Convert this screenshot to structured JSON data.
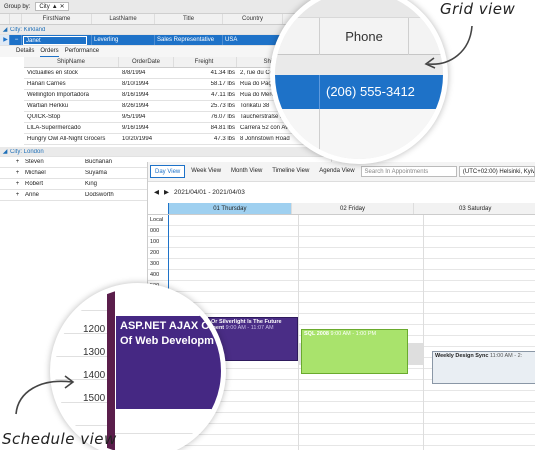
{
  "labels": {
    "grid_view": "Grid view",
    "schedule_view": "Schedule view"
  },
  "grid": {
    "group_by_label": "Group by:",
    "group_chip": "City",
    "columns": [
      "FirstName",
      "LastName",
      "Title",
      "Country"
    ],
    "group_kirkland": "City: Kirkland",
    "selected_row": {
      "first": "Janet",
      "last": "Leverling",
      "title": "Sales Representative",
      "country": "USA"
    },
    "tabs": [
      "Details",
      "Orders",
      "Performance"
    ],
    "sub_columns": [
      "ShipName",
      "OrderDate",
      "Freight",
      "ShipA"
    ],
    "orders": [
      {
        "ship": "Victuailles en stock",
        "date": "8/8/1994",
        "freight": "41.34 lbs",
        "addr": "2, rue du Comm"
      },
      {
        "ship": "Hanari Carnes",
        "date": "8/10/1994",
        "freight": "58.17 lbs",
        "addr": "Rua do Paço, 67"
      },
      {
        "ship": "Wellington Importadora",
        "date": "8/16/1994",
        "freight": "47.11 lbs",
        "addr": "Rua do Mercado, 1"
      },
      {
        "ship": "Wartian Herkku",
        "date": "8/26/1994",
        "freight": "25.73 lbs",
        "addr": "Torikatu 38"
      },
      {
        "ship": "QUICK-Stop",
        "date": "9/5/1994",
        "freight": "76.07 lbs",
        "addr": "Taucherstraße 10"
      },
      {
        "ship": "LILA-Supermercado",
        "date": "9/16/1994",
        "freight": "84.81 lbs",
        "addr": "Carrera 52 con Ave. Bolí..."
      },
      {
        "ship": "Hungry Owl All-Night Grocers",
        "date": "10/20/1994",
        "freight": "47.3 lbs",
        "addr": "8 Johnstown Road"
      }
    ],
    "group_london": "City: London",
    "london_rows": [
      {
        "first": "Steven",
        "last": "Buchanan"
      },
      {
        "first": "Michael",
        "last": "Suyama"
      },
      {
        "first": "Robert",
        "last": "King"
      },
      {
        "first": "Anne",
        "last": "Dodsworth"
      }
    ],
    "magnifier": {
      "header": "Phone",
      "value": "(206) 555-3412"
    }
  },
  "scheduler": {
    "views": [
      "Day View",
      "Week View",
      "Month View",
      "Timeline View",
      "Agenda View"
    ],
    "active_view": "Day View",
    "search_placeholder": "Search In Appointments",
    "timezone": "(UTC+02:00) Helsinki, Kyiv",
    "date_range": "2021/04/01 - 2021/04/03",
    "days": [
      "01 Thursday",
      "02 Friday",
      "03 Saturday"
    ],
    "local_label": "Local",
    "times": [
      "1000",
      "1100",
      "1200",
      "1300",
      "1400",
      "1500",
      "1600",
      "1700",
      "1800",
      "1900"
    ],
    "appointments": {
      "silverlight": {
        "title": "Or Silverlight Is The Future",
        "sub": "ment",
        "time": "9:00 AM - 11:07 AM"
      },
      "sql": {
        "title": "SQL 2008",
        "time": "9:00 AM - 1:00 PM"
      },
      "wds": {
        "title": "Weekly Design Sync",
        "time": "11:00 AM - 2:"
      }
    },
    "magnifier": {
      "line1": "ASP.NET AJAX O",
      "line2": "Of Web Developm",
      "times": [
        "1200",
        "1300",
        "1400",
        "1500"
      ]
    }
  },
  "colors": {
    "accent": "#1e72c8",
    "selected_row": "#1e72c8",
    "sql": "#a9e36c",
    "purple": "#4a2d86"
  }
}
